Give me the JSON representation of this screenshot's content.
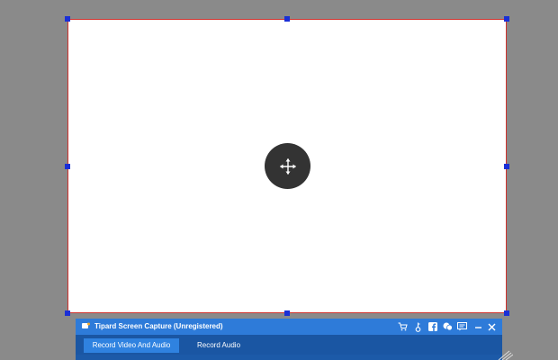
{
  "app": {
    "title": "Tipard Screen Capture (Unregistered)"
  },
  "tabs": [
    {
      "label": "Record Video And Audio",
      "active": true
    },
    {
      "label": "Record Audio",
      "active": false
    }
  ],
  "title_bar_icons": [
    "cart-icon",
    "key-icon",
    "facebook-icon",
    "chat-icon",
    "feedback-icon",
    "minimize-icon",
    "close-icon"
  ],
  "colors": {
    "region_border": "#d0312d",
    "handle": "#1a2fd6",
    "title_bar": "#2e7bd9",
    "tab_active": "#2f82e0"
  }
}
